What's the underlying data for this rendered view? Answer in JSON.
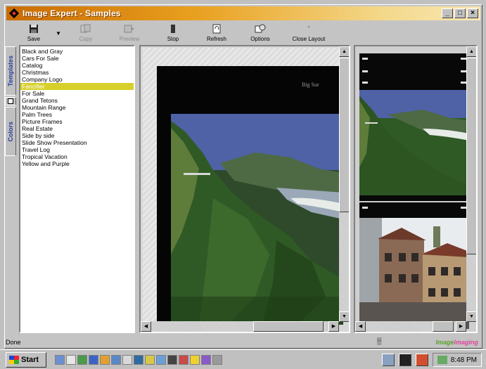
{
  "window": {
    "title": "Image Expert - Samples"
  },
  "title_controls": {
    "minimize": "_",
    "maximize": "□",
    "close": "×"
  },
  "toolbar": {
    "save": "Save",
    "copy": "Copy",
    "preview": "Preview",
    "stop": "Stop",
    "refresh": "Refresh",
    "options": "Options",
    "close_layout": "Close Layout"
  },
  "side_tabs": {
    "templates": "Templates",
    "colors": "Colors"
  },
  "templates": {
    "items": [
      "Black and Gray",
      "Cars For Sale",
      "Catalog",
      "Christmas",
      "Company Logo",
      "Fancifier",
      "For Sale",
      "Grand Tetons",
      "Mountain Range",
      "Palm Trees",
      "Picture Frames",
      "Real Estate",
      "Side by side",
      "Slide Show Presentation",
      "Travel Log",
      "Tropical Vacation",
      "Yellow and Purple"
    ],
    "selected_index": 5
  },
  "preview": {
    "tagline": "Big Sur"
  },
  "status": {
    "text": "Done",
    "middle": "▒",
    "brand_left": "Image",
    "brand_right": "Imaging"
  },
  "taskbar": {
    "start": "Start",
    "clock": "8:48 PM"
  },
  "colors": {
    "titlebar_start": "#c96b00",
    "titlebar_end": "#f7e7b5",
    "selection": "#d8d02a"
  }
}
